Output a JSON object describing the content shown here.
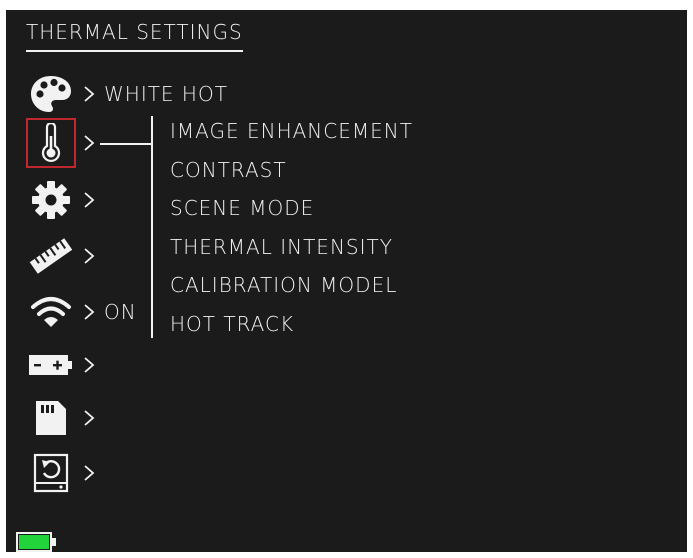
{
  "header": {
    "title": "THERMAL SETTINGS"
  },
  "menu": {
    "items": [
      {
        "icon": "palette-icon",
        "value": "WHITE HOT",
        "selected": false
      },
      {
        "icon": "thermometer-icon",
        "value": "",
        "selected": true
      },
      {
        "icon": "gear-icon",
        "value": "",
        "selected": false
      },
      {
        "icon": "ruler-icon",
        "value": "",
        "selected": false
      },
      {
        "icon": "wifi-icon",
        "value": "ON",
        "selected": false
      },
      {
        "icon": "battery-icon",
        "value": "",
        "selected": false
      },
      {
        "icon": "sd-card-icon",
        "value": "",
        "selected": false
      },
      {
        "icon": "reset-icon",
        "value": "",
        "selected": false
      }
    ]
  },
  "submenu": {
    "items": [
      "IMAGE ENHANCEMENT",
      "CONTRAST",
      "SCENE MODE",
      "THERMAL INTENSITY",
      "CALIBRATION MODEL",
      "HOT TRACK"
    ]
  },
  "status": {
    "battery_icon": "battery-full-icon",
    "battery_level": 1.0,
    "battery_color": "#22d33c"
  },
  "colors": {
    "selection": "#c0282d",
    "background": "#1b1b1b",
    "text": "#f2f2f2"
  }
}
